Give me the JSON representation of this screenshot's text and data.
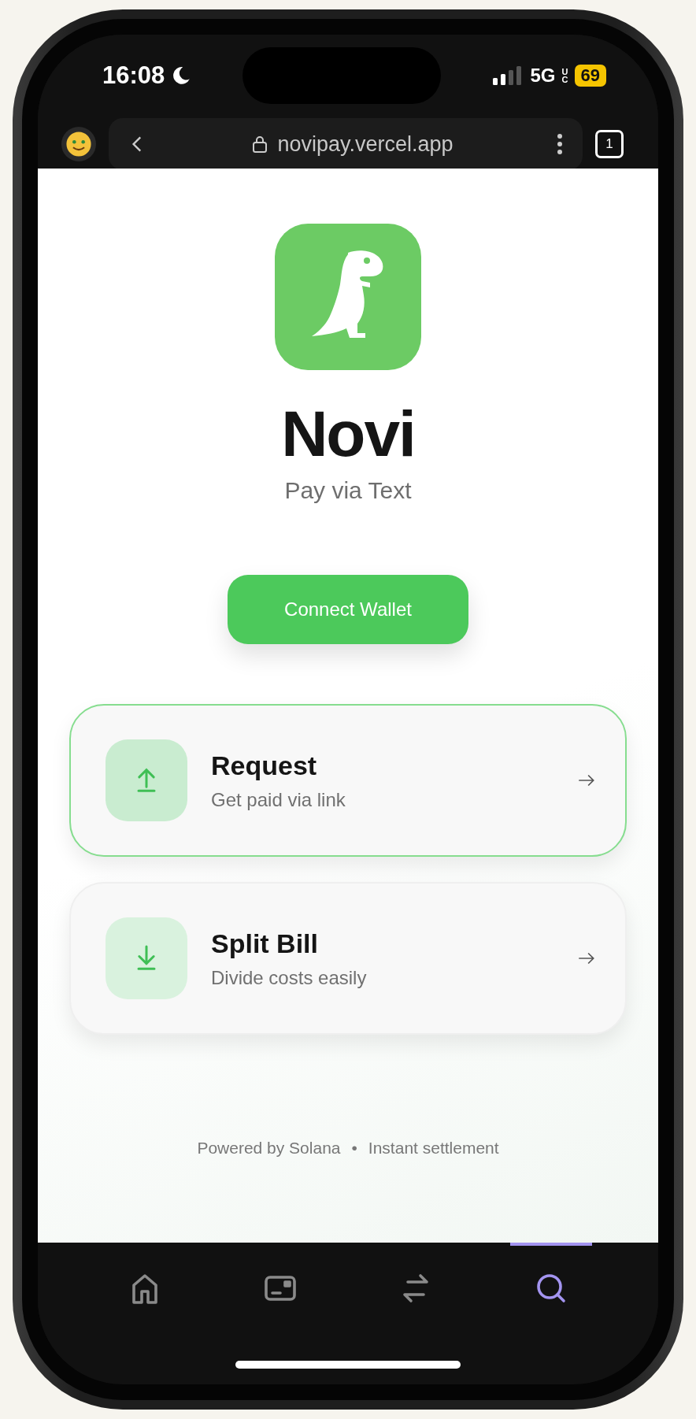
{
  "status_bar": {
    "time": "16:08",
    "network": "5G",
    "network_suffix": "UC",
    "battery": "69"
  },
  "browser": {
    "url": "novipay.vercel.app",
    "tab_count": "1"
  },
  "app": {
    "title": "Novi",
    "tagline": "Pay via Text",
    "button": "Connect Wallet"
  },
  "actions": [
    {
      "kind": "upload",
      "title": "Request",
      "subtitle": "Get paid via link",
      "selected": true
    },
    {
      "kind": "download",
      "title": "Split Bill",
      "subtitle": "Divide costs easily",
      "selected": false
    }
  ],
  "footer": [
    "Powered by Solana",
    "•",
    "Instant settlement"
  ],
  "nav": [
    {
      "kind": "home",
      "selected": false
    },
    {
      "kind": "wallet",
      "selected": false
    },
    {
      "kind": "swap",
      "selected": false
    },
    {
      "kind": "search",
      "selected": true
    }
  ]
}
